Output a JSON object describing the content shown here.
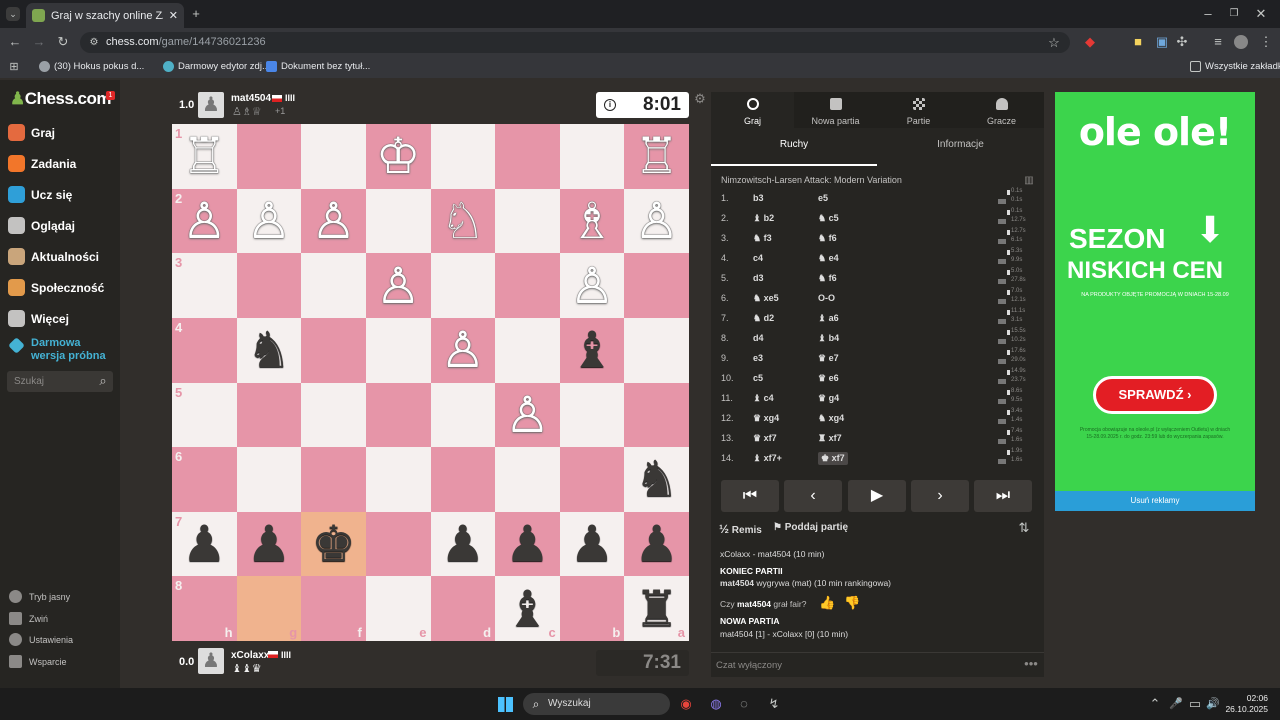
{
  "browser": {
    "tab_title": "Graj w szachy online ZA DARMO",
    "url_host": "chess.com",
    "url_path": "/game/144736021236",
    "bookmarks": [
      "(30) Hokus pokus d...",
      "Darmowy edytor zdj...",
      "Dokument bez tytuł..."
    ],
    "all_bookmarks": "Wszystkie zakładki"
  },
  "sidebar": {
    "logo": "Chess.com",
    "badge": "1",
    "items": [
      {
        "label": "Graj",
        "color": "#e46a3f"
      },
      {
        "label": "Zadania",
        "color": "#f2762a"
      },
      {
        "label": "Ucz się",
        "color": "#2f9fd8"
      },
      {
        "label": "Oglądaj",
        "color": "#c3c2c1"
      },
      {
        "label": "Aktualności",
        "color": "#c9a57b"
      },
      {
        "label": "Społeczność",
        "color": "#e29a4b"
      },
      {
        "label": "Więcej",
        "color": "#c3c2c1"
      }
    ],
    "trial_line1": "Darmowa",
    "trial_line2": "wersja próbna",
    "search_placeholder": "Szukaj",
    "bottom": [
      "Tryb jasny",
      "Zwiń",
      "Ustawienia",
      "Wsparcie"
    ]
  },
  "top_player": {
    "score": "1.0",
    "name": "mat4504",
    "rating_bars": "IIII",
    "captured_extra": "+1",
    "clock": "8:01"
  },
  "bottom_player": {
    "score": "0.0",
    "name": "xColaxx",
    "rating_bars": "IIII",
    "clock": "7:31"
  },
  "board": {
    "light_color": "#f5f0ef",
    "dark_color": "#e695a8",
    "highlight_color": "#f0b38e",
    "ranks": [
      "1",
      "2",
      "3",
      "4",
      "5",
      "6",
      "7",
      "8"
    ],
    "files": [
      "h",
      "g",
      "f",
      "e",
      "d",
      "c",
      "b",
      "a"
    ],
    "pieces": [
      [
        "♖",
        "",
        "",
        "♔",
        "",
        "",
        "",
        "♖"
      ],
      [
        "♙",
        "♙",
        "♙",
        "",
        "♘",
        "",
        "♗",
        "♙"
      ],
      [
        "",
        "",
        "",
        "♙",
        "",
        "",
        "♙",
        ""
      ],
      [
        "",
        "♞",
        "",
        "",
        "♙",
        "",
        "♝",
        ""
      ],
      [
        "",
        "",
        "",
        "",
        "",
        "♙",
        "",
        ""
      ],
      [
        "",
        "",
        "",
        "",
        "",
        "",
        "",
        "♞"
      ],
      [
        "♟",
        "♟",
        "♚",
        "",
        "♟",
        "♟",
        "♟",
        "♟"
      ],
      [
        "",
        "",
        "",
        "",
        "",
        "♝",
        "",
        "♜"
      ]
    ],
    "highlight_squares": [
      "6-2",
      "7-1"
    ]
  },
  "panel": {
    "tabs": [
      "Graj",
      "Nowa partia",
      "Partie",
      "Gracze"
    ],
    "subtabs": [
      "Ruchy",
      "Informacje"
    ],
    "opening": "Nimzowitsch-Larsen Attack: Modern Variation",
    "moves": [
      {
        "n": "1.",
        "w": "b3",
        "b": "e5",
        "tw": "0.1s",
        "tb": "0.1s"
      },
      {
        "n": "2.",
        "w": "♝ b2",
        "b": "♞ c5",
        "tw": "0.1s",
        "tb": "12.7s"
      },
      {
        "n": "3.",
        "w": "♞ f3",
        "b": "♞ f6",
        "tw": "12.7s",
        "tb": "6.1s"
      },
      {
        "n": "4.",
        "w": "c4",
        "b": "♞ e4",
        "tw": "5.3s",
        "tb": "9.9s"
      },
      {
        "n": "5.",
        "w": "d3",
        "b": "♞ f6",
        "tw": "5.0s",
        "tb": "27.8s"
      },
      {
        "n": "6.",
        "w": "♞ xe5",
        "b": "O-O",
        "tw": "7.0s",
        "tb": "12.1s"
      },
      {
        "n": "7.",
        "w": "♞ d2",
        "b": "♝ a6",
        "tw": "11.1s",
        "tb": "3.1s"
      },
      {
        "n": "8.",
        "w": "d4",
        "b": "♝ b4",
        "tw": "15.5s",
        "tb": "10.2s"
      },
      {
        "n": "9.",
        "w": "e3",
        "b": "♛ e7",
        "tw": "17.6s",
        "tb": "29.0s"
      },
      {
        "n": "10.",
        "w": "c5",
        "b": "♛ e6",
        "tw": "14.9s",
        "tb": "23.7s"
      },
      {
        "n": "11.",
        "w": "♝ c4",
        "b": "♛ g4",
        "tw": "8.6s",
        "tb": "9.5s"
      },
      {
        "n": "12.",
        "w": "♛ xg4",
        "b": "♞ xg4",
        "tw": "3.4s",
        "tb": "1.4s"
      },
      {
        "n": "13.",
        "w": "♛ xf7",
        "b": "♜ xf7",
        "tw": "7.4s",
        "tb": "1.6s"
      },
      {
        "n": "14.",
        "w": "♝ xf7+",
        "b": "♚ xf7",
        "tw": "1.9s",
        "tb": "1.6s"
      }
    ],
    "draw": "Remis",
    "resign": "Poddaj partię",
    "chat_lines": {
      "match": "xColaxx - mat4504 (10 min)",
      "end_title": "KONIEC PARTII",
      "end_winner": "mat4504",
      "end_text": " wygrywa (mat) (10 min rankingowa)",
      "fair_pre": "Czy ",
      "fair_name": "mat4504",
      "fair_post": " grał fair?",
      "new_title": "NOWA PARTIA",
      "new_text": "mat4504 [1] - xColaxx [0] (10 min)"
    },
    "chat_placeholder": "Czat wyłączony"
  },
  "ad": {
    "brand": "ole ole!",
    "headline1": "SEZON",
    "headline2": "NISKICH CEN",
    "sub": "NA PRODUKTY OBJĘTE PROMOCJĄ W DNIACH 15-28.09",
    "cta": "SPRAWDŹ",
    "fine": "Promocja obowiązuje na oleole.pl (z wyłączeniem Outletu) w dniach 15-28.09.2025 r. do godz. 23:59 lub do wyczerpania zapasów.",
    "remove": "Usuń reklamy"
  },
  "taskbar": {
    "search": "Wyszukaj",
    "time": "02:06",
    "date": "26.10.2025"
  }
}
